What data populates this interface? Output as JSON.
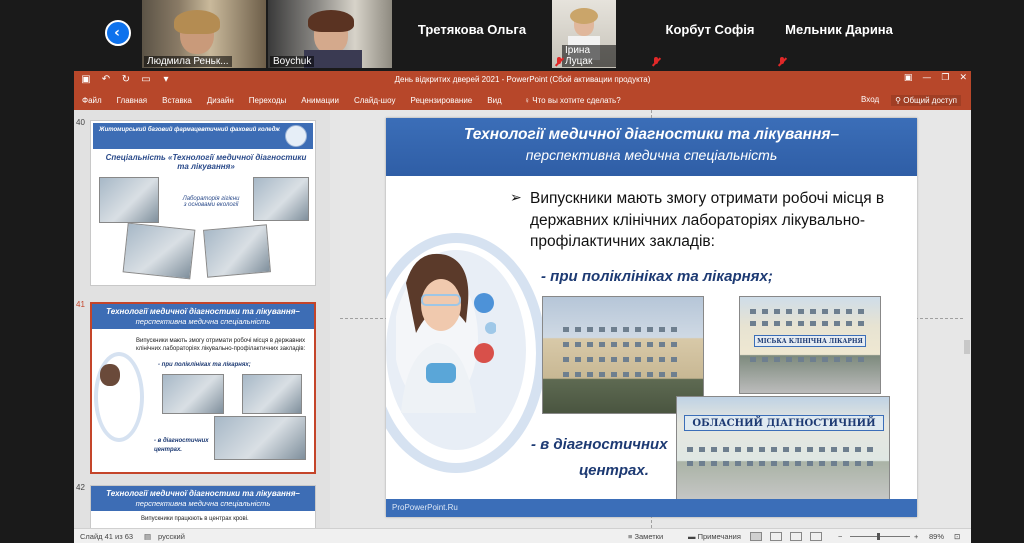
{
  "zoom": {
    "participants": [
      {
        "name": "Людмила Реньк...",
        "kind": "video"
      },
      {
        "name": "Boychuk",
        "kind": "video"
      },
      {
        "name": "Третякова Ольга",
        "kind": "name"
      },
      {
        "name": "Ірина Луцак",
        "kind": "video"
      },
      {
        "name": "Корбут Софія",
        "kind": "name"
      },
      {
        "name": "Мельник Дарина",
        "kind": "name"
      }
    ]
  },
  "window": {
    "title": "День відкритих дверей 2021 - PowerPoint (Сбой активации продукта)",
    "accent": "#b7472a"
  },
  "ribbon": {
    "tabs": [
      "Файл",
      "Главная",
      "Вставка",
      "Дизайн",
      "Переходы",
      "Анимации",
      "Слайд-шоу",
      "Рецензирование",
      "Вид"
    ],
    "tellme": "Что вы хотите сделать?",
    "signin": "Вход",
    "share": "Общий доступ"
  },
  "thumbnails": {
    "num40": "40",
    "num41": "41",
    "num42": "42",
    "t40": {
      "college": "Житомирський базовий фармацевтичний фаховий коледж",
      "specialty": "Спеціальність «Технології медичної діагностики та лікування»",
      "lab": "Лабораторія гігієни з основами екології"
    },
    "t41": {
      "bullet": "Випускники мають змогу отримати робочі місця в державних клінічних лабораторіях лікувально-профілактичних закладів:",
      "sub1": "- при поліклініках та лікарнях;",
      "sub2": "- в діагностичних центрах."
    },
    "t42": {
      "bullet": "Випускники працюють в центрах крові."
    }
  },
  "slide": {
    "title_line1": "Технології медичної діагностики та лікування–",
    "title_line2": "перспективна медична спеціальність",
    "bullet": "Випускники мають змогу отримати робочі місця в державних клінічних лабораторіях лікувально-профілактичних закладів:",
    "sub1": "- при поліклініках та лікарнях;",
    "sub2_line1": "- в діагностичних",
    "sub2_line2": "центрах.",
    "sign_clinic": "МІСЬКА КЛІНІЧНА ЛІКАРНЯ",
    "sign_center": "ОБЛАСНИЙ ДІАГНОСТИЧНИЙ",
    "footer": "ProPowerPoint.Ru"
  },
  "status": {
    "slide_info": "Слайд 41 из 63",
    "language": "русский",
    "notes": "Заметки",
    "comments": "Примечания",
    "zoom_level": "89%"
  }
}
